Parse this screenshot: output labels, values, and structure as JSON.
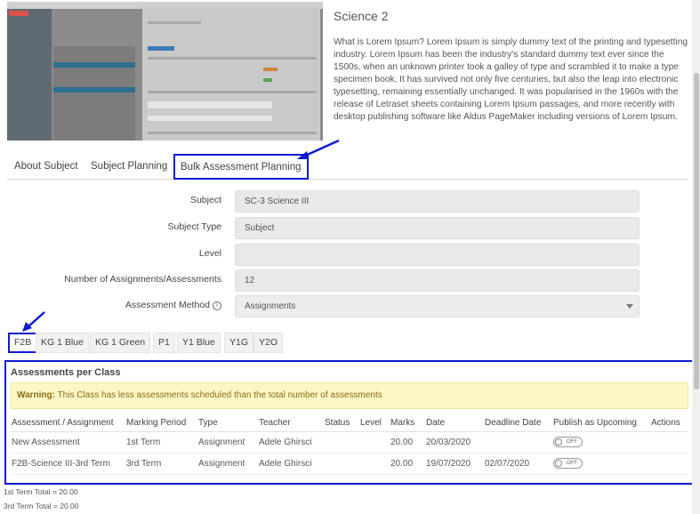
{
  "description": {
    "title": "Science 2",
    "body": "What is Lorem Ipsum? Lorem Ipsum is simply dummy text of the printing and typesetting industry. Lorem Ipsum has been the industry's standard dummy text ever since the 1500s, when an unknown printer took a galley of type and scrambled it to make a type specimen book. It has survived not only five centuries, but also the leap into electronic typesetting, remaining essentially unchanged. It was popularised in the 1960s with the release of Letraset sheets containing Lorem Ipsum passages, and more recently with desktop publishing software like Aldus PageMaker including versions of Lorem Ipsum."
  },
  "tabs": [
    {
      "label": "About Subject"
    },
    {
      "label": "Subject Planning"
    },
    {
      "label": "Bulk Assessment Planning",
      "active": true
    }
  ],
  "form": {
    "subject": {
      "label": "Subject",
      "value": "SC-3 Science III"
    },
    "subject_type": {
      "label": "Subject Type",
      "value": "Subject"
    },
    "level": {
      "label": "Level",
      "value": ""
    },
    "num_assessments": {
      "label": "Number of Assignments/Assessments",
      "value": "12"
    },
    "assessment_method": {
      "label": "Assessment Method",
      "value": "Assignments",
      "info_icon": "info-icon"
    }
  },
  "classes": [
    {
      "label": "F2B",
      "selected": true
    },
    {
      "label": "KG 1 Blue"
    },
    {
      "label": "KG 1 Green"
    },
    {
      "label": "P1"
    },
    {
      "label": "Y1 Blue"
    },
    {
      "label": "Y1G"
    },
    {
      "label": "Y2O"
    }
  ],
  "assessments": {
    "title": "Assessments per Class",
    "warning_label": "Warning:",
    "warning_text": " This Class has less assessments scheduled than the total number of assessments",
    "columns": {
      "assessment": "Assessment / Assignment",
      "period": "Marking Period",
      "type": "Type",
      "teacher": "Teacher",
      "status": "Status",
      "level": "Level",
      "marks": "Marks",
      "date": "Date",
      "deadline": "Deadline Date",
      "publish": "Publish as Upcoming",
      "actions": "Actions"
    },
    "rows": [
      {
        "assessment": "New Assessment",
        "period": "1st Term",
        "type": "Assignment",
        "teacher": "Adele Ghirsci",
        "status": "",
        "level": "",
        "marks": "20.00",
        "date": "20/03/2020",
        "deadline": "",
        "publish": "OFF"
      },
      {
        "assessment": "F2B-Science III-3rd Term",
        "period": "3rd Term",
        "type": "Assignment",
        "teacher": "Adele Ghirsci",
        "status": "",
        "level": "",
        "marks": "20.00",
        "date": "19/07/2020",
        "deadline": "02/07/2020",
        "publish": "OFF"
      }
    ]
  },
  "totals": [
    "1st Term Total = 20.00",
    "3rd Term Total = 20.00"
  ],
  "colors": {
    "highlight": "#0d1ad1",
    "warning_bg": "#fcf8c6",
    "field_bg": "#e9e9e9"
  }
}
